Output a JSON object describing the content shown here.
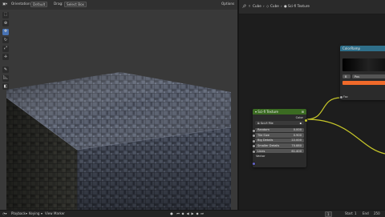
{
  "topbar": {
    "orientation_label": "Orientation:",
    "orientation_value": "Default",
    "drag_label": "Drag:",
    "drag_value": "Select Box",
    "options_label": "Options"
  },
  "node_editor": {
    "breadcrumbs": [
      "Cube",
      "Cube",
      "Sci-fi Texture"
    ]
  },
  "colorramp_node": {
    "title": "ColorRamp",
    "interp_label": "B",
    "interp_value": "Pos",
    "ramp_color": "#f06a2a",
    "fac_label": "Fac"
  },
  "scifi_node": {
    "title": "Sci-fi Texture",
    "output_label": "Color",
    "file_label": "Sci-fi File",
    "fields": [
      {
        "label": "Random",
        "value": "0.000"
      },
      {
        "label": "Tile Size",
        "value": "0.900"
      },
      {
        "label": "Big Details",
        "value": "22.000"
      },
      {
        "label": "Smaller Details",
        "value": "70.880"
      },
      {
        "label": "Lines",
        "value": "61.400"
      }
    ],
    "vector_label": "Vector"
  },
  "status": {
    "playback": "Playback",
    "keying": "Keying",
    "view": "View",
    "marker": "Marker",
    "frame_current": "1",
    "start_label": "Start",
    "start_value": "1",
    "end_label": "End",
    "end_value": "250"
  },
  "colors": {
    "accent": "#4772b3",
    "noodle": "#c7c729",
    "ramp_orange": "#f06a2a"
  }
}
